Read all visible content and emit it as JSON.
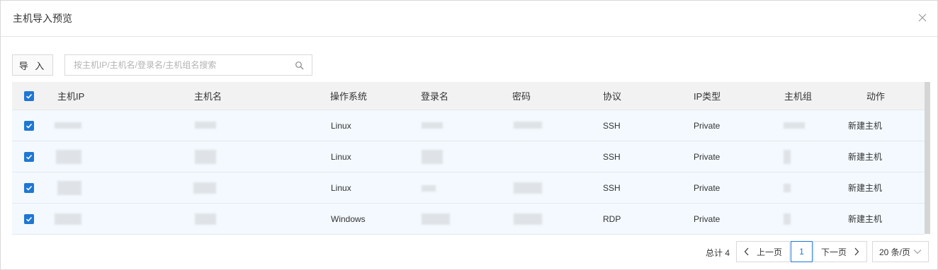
{
  "dialog": {
    "title": "主机导入预览",
    "close_icon": "close-icon"
  },
  "toolbar": {
    "import_label": "导 入",
    "search_placeholder": "按主机IP/主机名/登录名/主机组名搜索",
    "search_value": ""
  },
  "table": {
    "headers": [
      "主机IP",
      "主机名",
      "操作系统",
      "登录名",
      "密码",
      "协议",
      "IP类型",
      "主机组",
      "动作"
    ],
    "rows": [
      {
        "os": "Linux",
        "protocol": "SSH",
        "ip_type": "Private",
        "action": "新建主机",
        "checked": true
      },
      {
        "os": "Linux",
        "protocol": "SSH",
        "ip_type": "Private",
        "action": "新建主机",
        "checked": true
      },
      {
        "os": "Linux",
        "protocol": "SSH",
        "ip_type": "Private",
        "action": "新建主机",
        "checked": true
      },
      {
        "os": "Windows",
        "protocol": "RDP",
        "ip_type": "Private",
        "action": "新建主机",
        "checked": true
      }
    ],
    "select_all_checked": true
  },
  "pagination": {
    "total": "总计 4",
    "prev": "上一页",
    "current": "1",
    "next": "下一页",
    "page_size": "20 条/页"
  },
  "colors": {
    "accent": "#1f77d3",
    "row_bg": "#f3f9fe",
    "header_bg": "#f2f2f2"
  }
}
